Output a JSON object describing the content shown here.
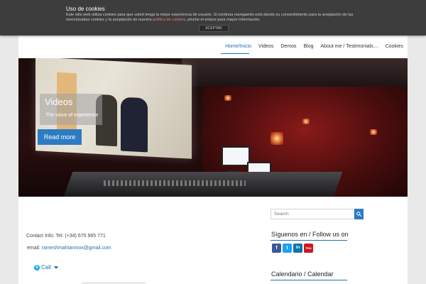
{
  "cookie": {
    "title": "Uso de cookies",
    "text_before_link": "Este sitio web utiliza cookies para que usted tenga la mejor experiencia de usuario. Si continúa navegando está dando su consentimiento para la aceptación de las mencionadas cookies y la aceptación de nuestra ",
    "link": "política de cookies",
    "text_after_link": ", pinche el enlace para mayor información.",
    "accept": "ACEPTAR"
  },
  "nav": {
    "items": [
      "Home/Inicio",
      "Videos",
      "Demos",
      "Blog",
      "About me / Testimonials…",
      "Cookies"
    ]
  },
  "hero": {
    "title": "Videos",
    "subtitle": "The voice of experience",
    "button": "Read more"
  },
  "content": {
    "contact": "Contact Info:  Tel: (+34) 670 965 771",
    "email_label": "email: ",
    "email": "rameshmahtanivox@gmail.com",
    "call": "Call"
  },
  "sidebar": {
    "search_placeholder": "Search",
    "follow_title": "Síguenos en / Follow us on",
    "calendar_title": "Calendario / Calendar",
    "socials": [
      {
        "icon": "facebook-icon",
        "glyph": "f",
        "color": "#3b5998"
      },
      {
        "icon": "twitter-icon",
        "glyph": "t",
        "color": "#1da1f2"
      },
      {
        "icon": "linkedin-icon",
        "glyph": "in",
        "color": "#0e76a8"
      },
      {
        "icon": "youtube-icon",
        "glyph": "You",
        "color": "#cc181e"
      }
    ]
  }
}
